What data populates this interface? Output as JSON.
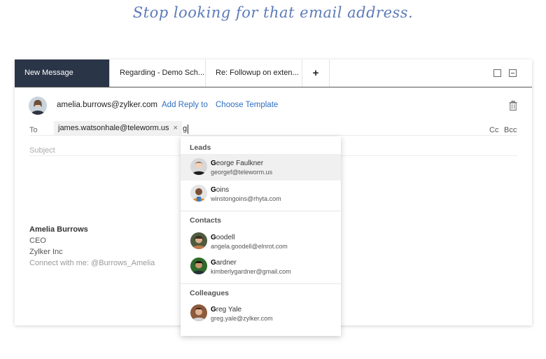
{
  "tagline": "Stop looking for that email address.",
  "tabs": [
    {
      "label": "New Message",
      "active": true
    },
    {
      "label": "Regarding - Demo Sch..."
    },
    {
      "label": "Re: Followup on exten..."
    },
    {
      "label": "+"
    }
  ],
  "compose": {
    "from_email": "amelia.burrows@zylker.com",
    "add_reply_to": "Add Reply to",
    "choose_template": "Choose Template",
    "to_label": "To",
    "recipient_chip": "james.watsonhale@teleworm.us",
    "chip_remove": "×",
    "to_input_value": "g",
    "cc": "Cc",
    "bcc": "Bcc",
    "subject_placeholder": "Subject"
  },
  "signature": {
    "name": "Amelia Burrows",
    "title": "CEO",
    "company": "Zylker Inc",
    "connect": "Connect with me: @Burrows_Amelia"
  },
  "suggestions": {
    "match_letter": "G",
    "groups": [
      {
        "title": "Leads",
        "items": [
          {
            "name_rest": "eorge Faulkner",
            "email": "georgef@teleworm.us"
          },
          {
            "name_rest": "oins",
            "email": "winstongoins@rhyta.com"
          }
        ]
      },
      {
        "title": "Contacts",
        "items": [
          {
            "name_rest": "oodell",
            "email": "angela.goodell@elnrot.com"
          },
          {
            "name_rest": "ardner",
            "email": "kimberlygardner@gmail.com"
          }
        ]
      },
      {
        "title": "Colleagues",
        "items": [
          {
            "name_rest": "reg Yale",
            "email": "greg.yale@zylker.com"
          }
        ]
      }
    ]
  },
  "colors": {
    "active_tab": "#2b3548",
    "link": "#2f6fbf",
    "tagline": "#5d7bb8"
  }
}
